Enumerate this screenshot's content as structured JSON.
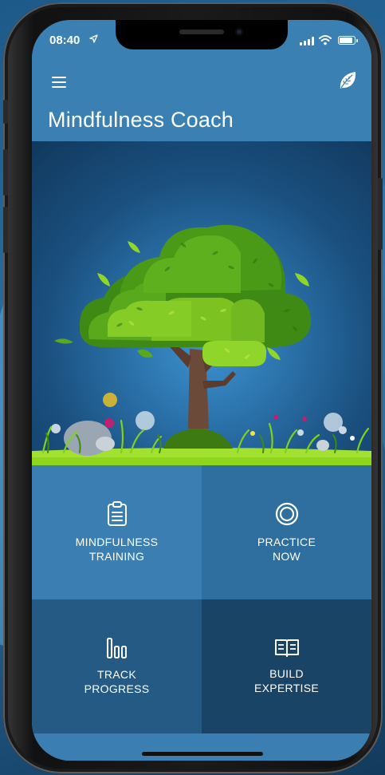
{
  "status_bar": {
    "time": "08:40"
  },
  "app_bar": {
    "title": "Mindfulness Coach",
    "menu_icon": "hamburger-menu-icon",
    "leaf_icon": "leaf-icon"
  },
  "hero": {
    "illustration": "tree-illustration"
  },
  "tiles": [
    {
      "label_line1": "MINDFULNESS",
      "label_line2": "TRAINING",
      "icon": "clipboard-list-icon"
    },
    {
      "label_line1": "PRACTICE",
      "label_line2": "NOW",
      "icon": "ring-target-icon"
    },
    {
      "label_line1": "TRACK",
      "label_line2": "PROGRESS",
      "icon": "bar-chart-icon"
    },
    {
      "label_line1": "BUILD",
      "label_line2": "EXPERTISE",
      "icon": "open-book-icon"
    }
  ],
  "colors": {
    "appbar": "#3a80b2",
    "tile_dark": "#1a4466",
    "grass": "#8ed61e",
    "foliage": "#6fbd1e"
  }
}
